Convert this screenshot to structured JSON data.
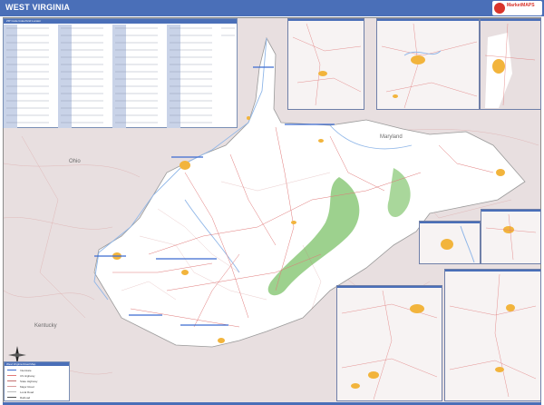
{
  "title": "WEST VIRGINIA",
  "logo": {
    "line1": "MarketMAPS",
    "line2": "",
    "icon": "globe-icon"
  },
  "index_panel": {
    "heading": "ZIP Code Index/Grid Locator"
  },
  "legend": {
    "heading": "West Virginia Road Map",
    "rows": [
      "Interstate",
      "US Highway",
      "State Highway",
      "Major Road",
      "Local Road",
      "Railroad"
    ]
  },
  "labels": {
    "ohio": "Ohio",
    "maryland": "Maryland",
    "kentucky": "Kentucky"
  },
  "colors": {
    "header": "#4a6fb8",
    "state_fill": "#ffffff",
    "neighbor_fill": "#e8dfe0",
    "forest": "#8cc97a",
    "urban": "#f2b43c",
    "road": "#e07878",
    "water": "#8fb6e8"
  },
  "compass_icon": "compass-rose-icon"
}
